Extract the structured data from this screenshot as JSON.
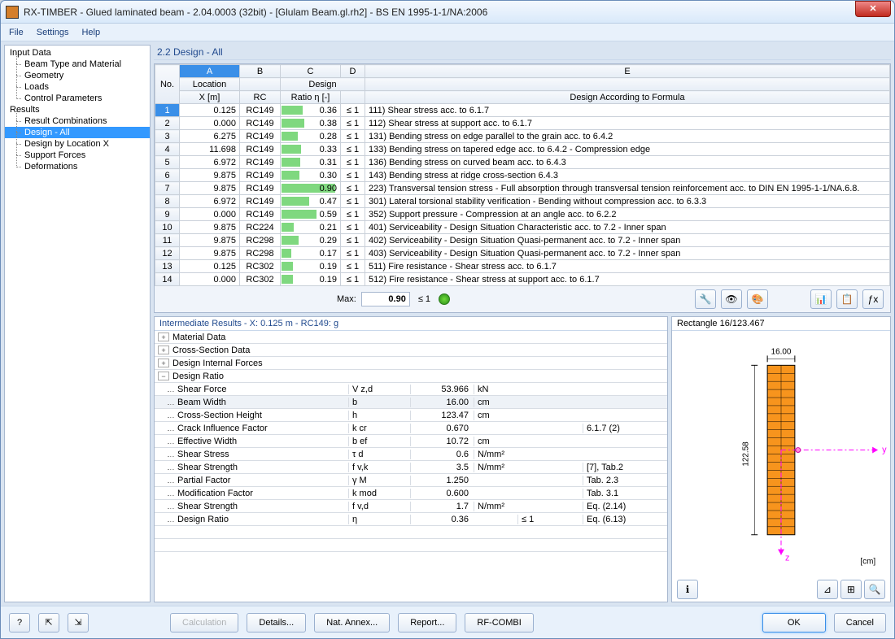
{
  "window": {
    "title": "RX-TIMBER - Glued laminated beam - 2.04.0003 (32bit) - [Glulam Beam.gl.rh2] - BS EN 1995-1-1/NA:2006"
  },
  "menu": [
    "File",
    "Settings",
    "Help"
  ],
  "tree": {
    "input_root": "Input Data",
    "input_items": [
      "Beam Type and Material",
      "Geometry",
      "Loads",
      "Control Parameters"
    ],
    "results_root": "Results",
    "results_items": [
      "Result Combinations",
      "Design - All",
      "Design by Location X",
      "Support Forces",
      "Deformations"
    ],
    "selected": "Design - All"
  },
  "panel_title": "2.2 Design - All",
  "grid": {
    "col_letters": [
      "A",
      "B",
      "C",
      "D",
      "E"
    ],
    "group_headers": {
      "a": "Location",
      "b": "",
      "cd": "Design",
      "e": ""
    },
    "headers": {
      "no": "No.",
      "x": "X [m]",
      "rc": "RC",
      "ratio": "Ratio η [-]",
      "cond": "",
      "desc": "Design According to Formula"
    },
    "rows": [
      {
        "no": 1,
        "x": "0.125",
        "rc": "RC149",
        "ratio": 0.36,
        "cond": "≤ 1",
        "desc": "111) Shear stress acc. to 6.1.7"
      },
      {
        "no": 2,
        "x": "0.000",
        "rc": "RC149",
        "ratio": 0.38,
        "cond": "≤ 1",
        "desc": "112) Shear stress at support acc. to 6.1.7"
      },
      {
        "no": 3,
        "x": "6.275",
        "rc": "RC149",
        "ratio": 0.28,
        "cond": "≤ 1",
        "desc": "131) Bending stress on edge parallel to the grain acc. to 6.4.2"
      },
      {
        "no": 4,
        "x": "11.698",
        "rc": "RC149",
        "ratio": 0.33,
        "cond": "≤ 1",
        "desc": "133) Bending stress on tapered edge acc. to 6.4.2 - Compression edge"
      },
      {
        "no": 5,
        "x": "6.972",
        "rc": "RC149",
        "ratio": 0.31,
        "cond": "≤ 1",
        "desc": "136) Bending stress on curved beam acc. to 6.4.3"
      },
      {
        "no": 6,
        "x": "9.875",
        "rc": "RC149",
        "ratio": 0.3,
        "cond": "≤ 1",
        "desc": "143) Bending stress at ridge cross-section 6.4.3"
      },
      {
        "no": 7,
        "x": "9.875",
        "rc": "RC149",
        "ratio": 0.9,
        "cond": "≤ 1",
        "desc": "223) Transversal tension stress - Full absorption through transversal tension reinforcement acc. to DIN EN 1995-1-1/NA.6.8."
      },
      {
        "no": 8,
        "x": "6.972",
        "rc": "RC149",
        "ratio": 0.47,
        "cond": "≤ 1",
        "desc": "301) Lateral torsional stability verification - Bending without compression acc. to 6.3.3"
      },
      {
        "no": 9,
        "x": "0.000",
        "rc": "RC149",
        "ratio": 0.59,
        "cond": "≤ 1",
        "desc": "352) Support pressure - Compression at an angle acc. to 6.2.2"
      },
      {
        "no": 10,
        "x": "9.875",
        "rc": "RC224",
        "ratio": 0.21,
        "cond": "≤ 1",
        "desc": "401) Serviceability - Design Situation Characteristic acc. to 7.2 - Inner span"
      },
      {
        "no": 11,
        "x": "9.875",
        "rc": "RC298",
        "ratio": 0.29,
        "cond": "≤ 1",
        "desc": "402) Serviceability - Design Situation Quasi-permanent acc. to 7.2 - Inner span"
      },
      {
        "no": 12,
        "x": "9.875",
        "rc": "RC298",
        "ratio": 0.17,
        "cond": "≤ 1",
        "desc": "403) Serviceability - Design Situation Quasi-permanent acc. to 7.2 - Inner span"
      },
      {
        "no": 13,
        "x": "0.125",
        "rc": "RC302",
        "ratio": 0.19,
        "cond": "≤ 1",
        "desc": "511) Fire resistance - Shear stress acc. to 6.1.7"
      },
      {
        "no": 14,
        "x": "0.000",
        "rc": "RC302",
        "ratio": 0.19,
        "cond": "≤ 1",
        "desc": "512) Fire resistance - Shear stress at support acc. to 6.1.7"
      }
    ],
    "max": {
      "label": "Max:",
      "value": "0.90",
      "cond": "≤ 1"
    }
  },
  "details": {
    "title": "Intermediate Results  -  X: 0.125 m  -  RC149: g",
    "groups": [
      "Material Data",
      "Cross-Section Data",
      "Design Internal Forces",
      "Design Ratio"
    ],
    "rows": [
      {
        "label": "Shear Force",
        "sym": "V z,d",
        "val": "53.966",
        "unit": "kN",
        "cond": "",
        "ref": ""
      },
      {
        "label": "Beam Width",
        "sym": "b",
        "val": "16.00",
        "unit": "cm",
        "cond": "",
        "ref": "",
        "shade": true
      },
      {
        "label": "Cross-Section Height",
        "sym": "h",
        "val": "123.47",
        "unit": "cm",
        "cond": "",
        "ref": ""
      },
      {
        "label": "Crack Influence Factor",
        "sym": "k cr",
        "val": "0.670",
        "unit": "",
        "cond": "",
        "ref": "6.1.7 (2)"
      },
      {
        "label": "Effective Width",
        "sym": "b ef",
        "val": "10.72",
        "unit": "cm",
        "cond": "",
        "ref": ""
      },
      {
        "label": "Shear Stress",
        "sym": "τ d",
        "val": "0.6",
        "unit": "N/mm²",
        "cond": "",
        "ref": ""
      },
      {
        "label": "Shear Strength",
        "sym": "f v,k",
        "val": "3.5",
        "unit": "N/mm²",
        "cond": "",
        "ref": "[7], Tab.2"
      },
      {
        "label": "Partial Factor",
        "sym": "γ M",
        "val": "1.250",
        "unit": "",
        "cond": "",
        "ref": "Tab. 2.3"
      },
      {
        "label": "Modification Factor",
        "sym": "k mod",
        "val": "0.600",
        "unit": "",
        "cond": "",
        "ref": "Tab. 3.1"
      },
      {
        "label": "Shear Strength",
        "sym": "f v,d",
        "val": "1.7",
        "unit": "N/mm²",
        "cond": "",
        "ref": "Eq. (2.14)"
      },
      {
        "label": "Design Ratio",
        "sym": "η",
        "val": "0.36",
        "unit": "",
        "cond": "≤ 1",
        "ref": "Eq. (6.13)"
      }
    ]
  },
  "preview": {
    "title": "Rectangle 16/123.467",
    "width": "16.00",
    "height": "122.58",
    "unit": "[cm]"
  },
  "footer": {
    "calc": "Calculation",
    "details": "Details...",
    "annex": "Nat. Annex...",
    "report": "Report...",
    "combi": "RF-COMBI",
    "ok": "OK",
    "cancel": "Cancel"
  }
}
